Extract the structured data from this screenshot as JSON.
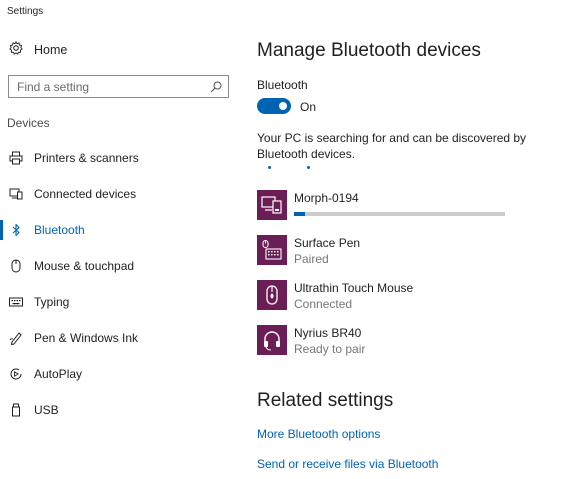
{
  "window": {
    "title": "Settings"
  },
  "sidebar": {
    "home_label": "Home",
    "search": {
      "placeholder": "Find a setting"
    },
    "section_label": "Devices",
    "items": [
      {
        "label": "Printers & scanners",
        "icon": "printer-icon"
      },
      {
        "label": "Connected devices",
        "icon": "connected-devices-icon"
      },
      {
        "label": "Bluetooth",
        "icon": "bluetooth-icon",
        "active": true
      },
      {
        "label": "Mouse & touchpad",
        "icon": "mouse-icon"
      },
      {
        "label": "Typing",
        "icon": "keyboard-icon"
      },
      {
        "label": "Pen & Windows Ink",
        "icon": "pen-icon"
      },
      {
        "label": "AutoPlay",
        "icon": "autoplay-icon"
      },
      {
        "label": "USB",
        "icon": "usb-icon"
      }
    ]
  },
  "main": {
    "title": "Manage Bluetooth devices",
    "bluetooth_label": "Bluetooth",
    "toggle": {
      "state": "On",
      "on": true
    },
    "description": "Your PC is searching for and can be discovered by Bluetooth devices.",
    "devices": [
      {
        "name": "Morph-0194",
        "status": "",
        "icon": "pc-phone-icon",
        "progress": 0.05
      },
      {
        "name": "Surface Pen",
        "status": "Paired",
        "icon": "pen-keyboard-icon"
      },
      {
        "name": "Ultrathin Touch Mouse",
        "status": "Connected",
        "icon": "mouse-icon"
      },
      {
        "name": "Nyrius BR40",
        "status": "Ready to pair",
        "icon": "headset-icon"
      }
    ]
  },
  "related": {
    "title": "Related settings",
    "links": [
      "More Bluetooth options",
      "Send or receive files via Bluetooth"
    ]
  },
  "colors": {
    "accent": "#0063b1",
    "device_tile": "#6b1d55"
  }
}
